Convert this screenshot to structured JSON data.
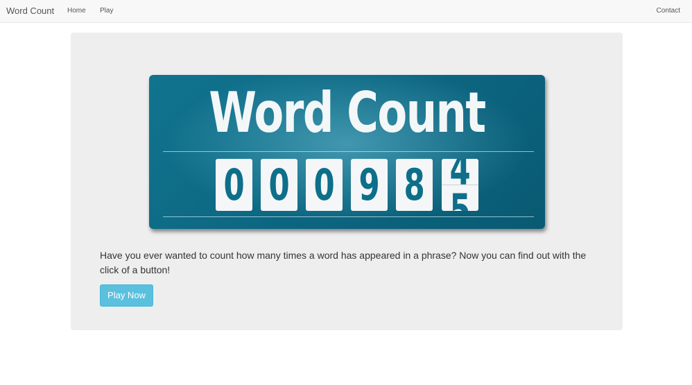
{
  "navbar": {
    "brand": "Word Count",
    "links": [
      "Home",
      "Play"
    ],
    "right_link": "Contact"
  },
  "hero": {
    "logo": {
      "title": "Word Count",
      "digits": [
        "0",
        "0",
        "0",
        "9",
        "8"
      ],
      "flip_digit_top": "4",
      "flip_digit_bottom": "5"
    },
    "description": "Have you ever wanted to count how many times a word has appeared in a phrase? Now you can find out with the click of a button!",
    "button_label": "Play Now"
  },
  "colors": {
    "accent": "#5bc0de",
    "logo_teal": "#0c6580",
    "digit_teal": "#0d6f8a",
    "navbar_bg": "#f8f8f8",
    "jumbotron_bg": "#eeeeee"
  }
}
